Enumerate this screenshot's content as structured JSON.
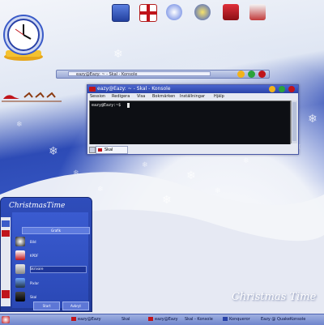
{
  "desktop": {
    "brand_text": "Christmas Time"
  },
  "minibar": {
    "task_title": "eazy@Eazy: ~ - Skal - Konsole"
  },
  "konsole": {
    "title": "eazy@Eazy: ~ - Skal - Konsole",
    "menu": [
      "Session",
      "Redigera",
      "Visa",
      "Bokmärken",
      "Inställningar",
      "Hjälp"
    ],
    "prompt": "eazy@Eazy:~$",
    "tab_label": "Skal"
  },
  "side_panel": {
    "title": "ChristmasTime",
    "header_label": "Grafik",
    "items": [
      {
        "label": "Bild"
      },
      {
        "label": "KPDF"
      },
      {
        "label": "Skrivare"
      },
      {
        "label": "Pixlar"
      },
      {
        "label": "Skal"
      }
    ],
    "ok_label": "Start",
    "cancel_label": "Avbryt"
  },
  "taskbar": {
    "items": [
      {
        "label": "eazy@Eazy"
      },
      {
        "label": "Skal"
      },
      {
        "label": "eazy@Eazy"
      },
      {
        "label": "Skal - Konsole"
      },
      {
        "label": "Konqueror"
      },
      {
        "label": "Eazy @ QuakeKonsole"
      }
    ]
  },
  "colors": {
    "accent": "#2a43a8",
    "title_red": "#c0141b"
  }
}
